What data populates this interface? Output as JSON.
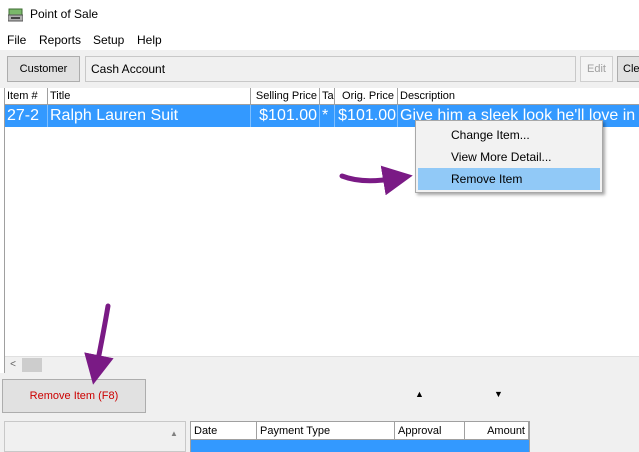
{
  "window": {
    "title": "Point of Sale"
  },
  "menu": [
    "File",
    "Reports",
    "Setup",
    "Help"
  ],
  "toolbar": {
    "customer_label": "Customer",
    "account_value": "Cash Account",
    "edit_label": "Edit",
    "clear_label": "Clea"
  },
  "grid": {
    "columns": [
      "Item #",
      "Title",
      "Selling Price",
      "Ta",
      "Orig. Price",
      "Description"
    ],
    "rows": [
      {
        "item": "27-2",
        "title": "Ralph Lauren Suit",
        "price": "$101.00",
        "tax": "*",
        "orig": "$101.00",
        "desc": "Give him a sleek look he'll love in this"
      }
    ]
  },
  "context_menu": {
    "items": [
      "Change Item...",
      "View More Detail...",
      "Remove Item"
    ],
    "highlighted": "Remove Item"
  },
  "bottom": {
    "remove_label": "Remove Item (F8)",
    "up_arrow": "▲",
    "down_arrow": "▼",
    "scroll_left": "<",
    "small_up": "▲"
  },
  "payments": {
    "columns": [
      "Date",
      "Payment Type",
      "Approval",
      "Amount"
    ]
  },
  "colors": {
    "selection": "#3399ff",
    "annotation_arrow": "#7a1a85",
    "remove_text": "#cc0000"
  }
}
